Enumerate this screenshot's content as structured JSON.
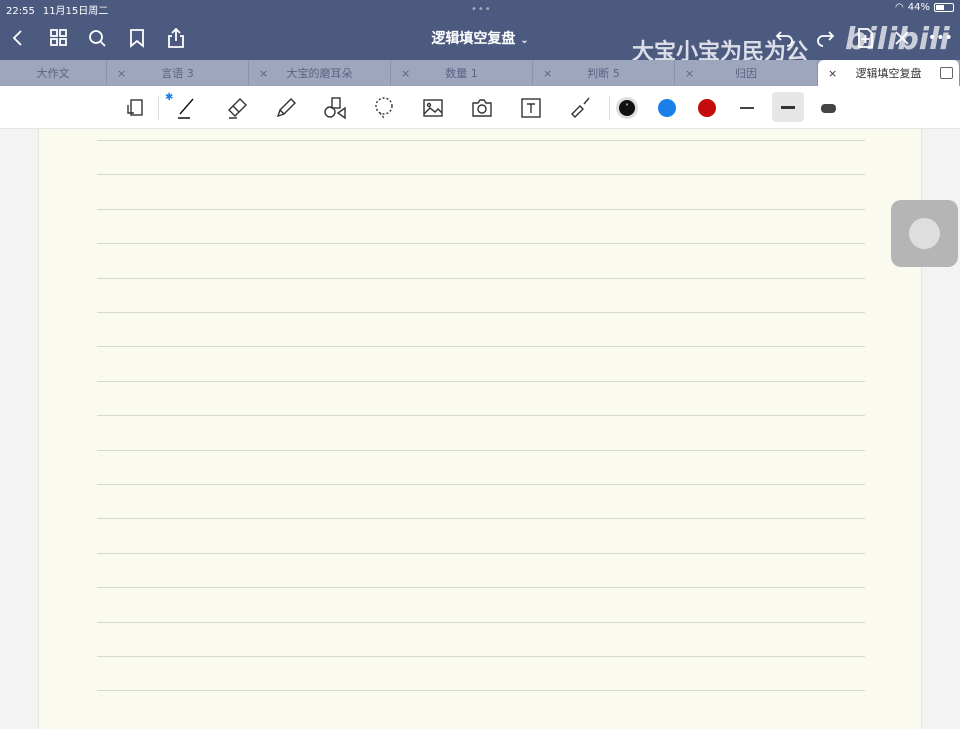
{
  "status": {
    "time": "22:55",
    "date": "11月15日周二",
    "battery": "44%",
    "battery_level": 0.44
  },
  "header": {
    "title": "逻辑填空复盘",
    "watermark": "大宝小宝为民为公",
    "logo": "bilibili"
  },
  "tabs": [
    {
      "label": "大作文",
      "closable": false
    },
    {
      "label": "言语 3",
      "closable": true
    },
    {
      "label": "大宝的磨耳朵",
      "closable": true
    },
    {
      "label": "数量 1",
      "closable": true
    },
    {
      "label": "判断 5",
      "closable": true
    },
    {
      "label": "归因",
      "closable": true
    },
    {
      "label": "逻辑填空复盘",
      "closable": true,
      "active": true
    }
  ],
  "close_glyph": "×",
  "colors": {
    "black": "#111111",
    "blue": "#1a7fe8",
    "red": "#c40c0c",
    "accent": "#4d5a80"
  }
}
